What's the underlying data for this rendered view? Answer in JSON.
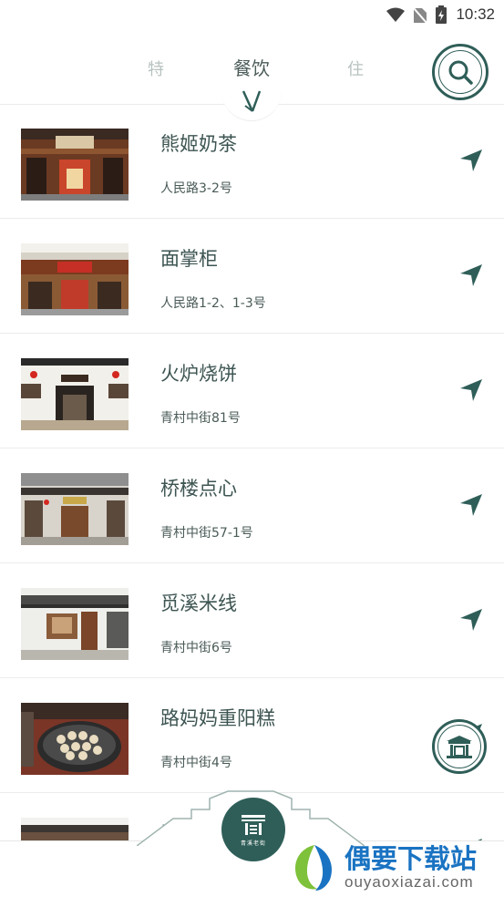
{
  "status_bar": {
    "time": "10:32"
  },
  "header": {
    "tab_left": "特",
    "tab_active": "餐饮",
    "tab_right": "住"
  },
  "shops": [
    {
      "name": "熊姬奶茶",
      "address": "人民路3-2号"
    },
    {
      "name": "面掌柜",
      "address": "人民路1-2、1-3号"
    },
    {
      "name": "火炉烧饼",
      "address": "青村中街81号"
    },
    {
      "name": "桥楼点心",
      "address": "青村中街57-1号"
    },
    {
      "name": "觅溪米线",
      "address": "青村中街6号"
    },
    {
      "name": "路妈妈重阳糕",
      "address": "青村中街4号"
    },
    {
      "name": "青",
      "address": ""
    }
  ],
  "bottom": {
    "home_subtitle": "青溪老街"
  },
  "watermark": {
    "title": "偶要下载站",
    "url": "ouyaoxiazai.com"
  },
  "colors": {
    "accent": "#2f5e58",
    "watermark_blue": "#1a73c2"
  }
}
